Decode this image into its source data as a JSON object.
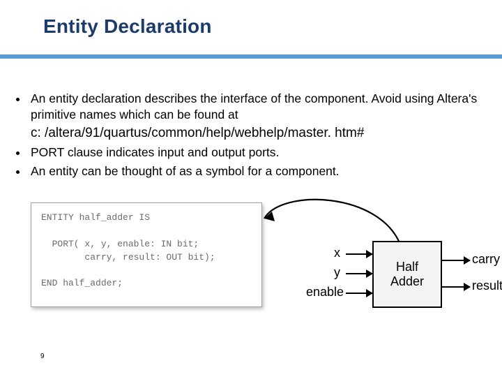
{
  "title": "Entity Declaration",
  "bullets": {
    "b1a": "An entity declaration describes the interface of the component. Avoid using Altera's primitive names which can be found at",
    "b1b": "c: /altera/91/quartus/common/help/webhelp/master. htm#",
    "b2": "PORT clause indicates input and output ports.",
    "b3": "An entity can be thought of as a symbol for a component."
  },
  "code": {
    "l1": "ENTITY half_adder IS",
    "l2": "",
    "l3": "  PORT( x, y, enable: IN bit;",
    "l4": "        carry, result: OUT bit);",
    "l5": "",
    "l6": "END half_adder;"
  },
  "block": {
    "name_l1": "Half",
    "name_l2": "Adder",
    "in1": "x",
    "in2": "y",
    "in3": "enable",
    "out1": "carry",
    "out2": "result"
  },
  "page": "9"
}
